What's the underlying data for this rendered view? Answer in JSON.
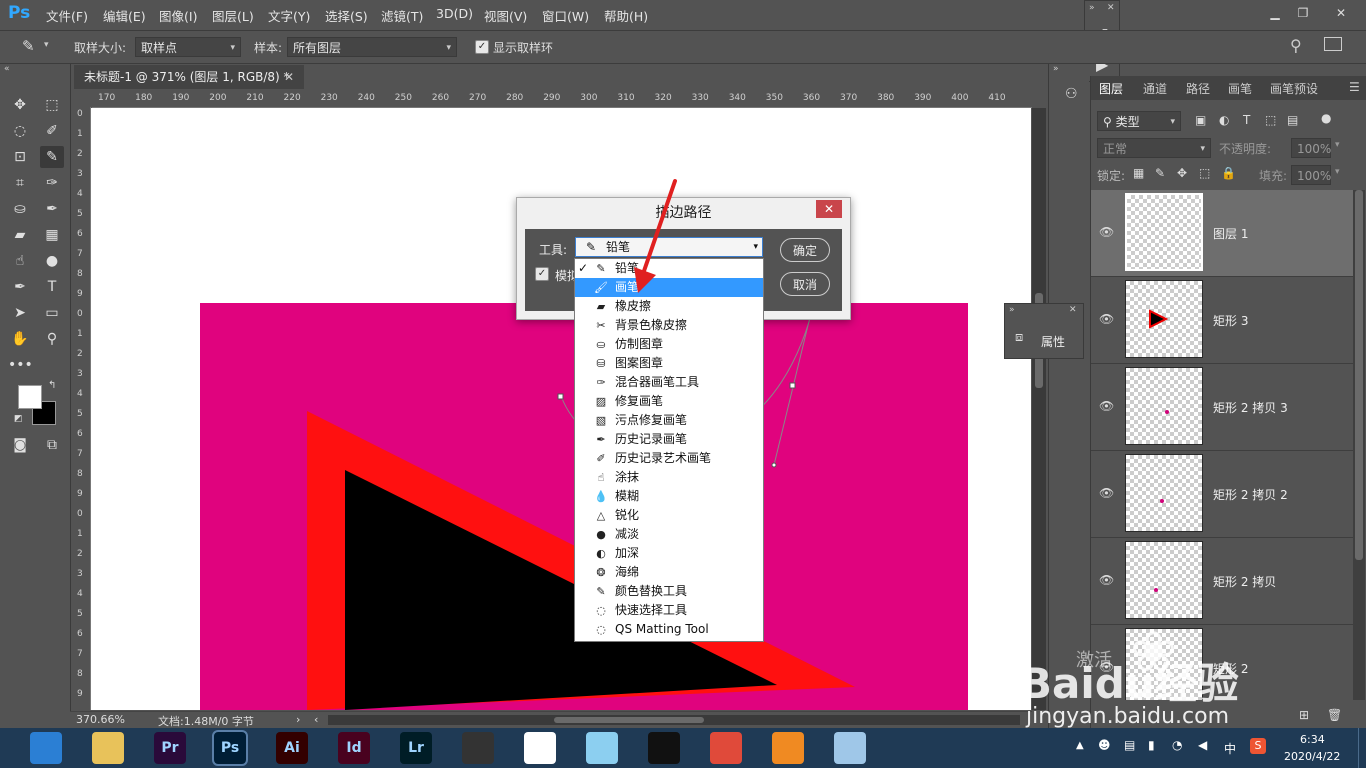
{
  "app": {
    "logo": "Ps"
  },
  "menu": [
    "文件(F)",
    "编辑(E)",
    "图像(I)",
    "图层(L)",
    "文字(Y)",
    "选择(S)",
    "滤镜(T)",
    "3D(D)",
    "视图(V)",
    "窗口(W)",
    "帮助(H)"
  ],
  "options": {
    "sample_size_label": "取样大小:",
    "sample_size_value": "取样点",
    "sample_label": "样本:",
    "sample_value": "所有图层",
    "show_ring_label": "显示取样环"
  },
  "document": {
    "tab_title": "未标题-1 @ 371% (图层 1, RGB/8) *",
    "zoom": "370.66%",
    "doc_info": "文档:1.48M/0 字节"
  },
  "ruler_h": [
    "170",
    "180",
    "190",
    "200",
    "210",
    "220",
    "230",
    "240",
    "250",
    "260",
    "270",
    "280",
    "290",
    "300",
    "310",
    "320",
    "330",
    "340",
    "350",
    "360",
    "370",
    "380",
    "390",
    "400",
    "410"
  ],
  "ruler_v": [
    "0",
    "1",
    "2",
    "3",
    "4",
    "5",
    "6",
    "7",
    "8",
    "9",
    "0",
    "1",
    "2",
    "3",
    "4",
    "5",
    "6",
    "7",
    "8",
    "9",
    "0",
    "1",
    "2",
    "3",
    "4",
    "5",
    "6",
    "7",
    "8",
    "9"
  ],
  "dialog": {
    "title": "描边路径",
    "close": "✕",
    "tool_label": "工具:",
    "tool_value": "铅笔",
    "simulate_label": "模拟",
    "ok": "确定",
    "cancel": "取消"
  },
  "tool_options": [
    {
      "label": "铅笔",
      "icon": "pencil-icon",
      "glyph": "✎",
      "checked": true
    },
    {
      "label": "画笔",
      "icon": "brush-icon",
      "glyph": "🖌",
      "selected": true
    },
    {
      "label": "橡皮擦",
      "icon": "eraser-icon",
      "glyph": "▰"
    },
    {
      "label": "背景色橡皮擦",
      "icon": "background-eraser-icon",
      "glyph": "✂"
    },
    {
      "label": "仿制图章",
      "icon": "clone-stamp-icon",
      "glyph": "⛀"
    },
    {
      "label": "图案图章",
      "icon": "pattern-stamp-icon",
      "glyph": "⛁"
    },
    {
      "label": "混合器画笔工具",
      "icon": "mixer-brush-icon",
      "glyph": "✑"
    },
    {
      "label": "修复画笔",
      "icon": "healing-brush-icon",
      "glyph": "▨"
    },
    {
      "label": "污点修复画笔",
      "icon": "spot-healing-icon",
      "glyph": "▧"
    },
    {
      "label": "历史记录画笔",
      "icon": "history-brush-icon",
      "glyph": "✒"
    },
    {
      "label": "历史记录艺术画笔",
      "icon": "art-history-brush-icon",
      "glyph": "✐"
    },
    {
      "label": "涂抹",
      "icon": "smudge-icon",
      "glyph": "☝"
    },
    {
      "label": "模糊",
      "icon": "blur-icon",
      "glyph": "💧"
    },
    {
      "label": "锐化",
      "icon": "sharpen-icon",
      "glyph": "△"
    },
    {
      "label": "减淡",
      "icon": "dodge-icon",
      "glyph": "●"
    },
    {
      "label": "加深",
      "icon": "burn-icon",
      "glyph": "◐"
    },
    {
      "label": "海绵",
      "icon": "sponge-icon",
      "glyph": "❂"
    },
    {
      "label": "颜色替换工具",
      "icon": "color-replace-icon",
      "glyph": "✎"
    },
    {
      "label": "快速选择工具",
      "icon": "quick-select-icon",
      "glyph": "◌"
    },
    {
      "label": "QS Matting Tool",
      "icon": "qs-matting-icon",
      "glyph": "◌"
    }
  ],
  "panel": {
    "tabs": [
      "图层",
      "通道",
      "路径",
      "画笔",
      "画笔预设"
    ],
    "filter_label": "类型",
    "blend_mode": "正常",
    "opacity_label": "不透明度:",
    "opacity_value": "100%",
    "lock_label": "锁定:",
    "fill_label": "填充:",
    "fill_value": "100%",
    "layers": [
      "图层 1",
      "矩形 3",
      "矩形 2 拷贝 3",
      "矩形 2 拷贝 2",
      "矩形 2 拷贝",
      "矩形 2"
    ],
    "properties_label": "属性"
  },
  "taskbar": {
    "time": "6:34",
    "date": "2020/4/22",
    "ime": "中",
    "apps": [
      {
        "name": "browser-icon",
        "label": "",
        "color": "#2b7fd4"
      },
      {
        "name": "file-explorer-icon",
        "label": "",
        "color": "#e8c25a"
      },
      {
        "name": "premiere-icon",
        "label": "Pr",
        "color": "#2a0a3a"
      },
      {
        "name": "photoshop-icon",
        "label": "Ps",
        "color": "#001e36"
      },
      {
        "name": "illustrator-icon",
        "label": "Ai",
        "color": "#330000"
      },
      {
        "name": "indesign-icon",
        "label": "Id",
        "color": "#49021f"
      },
      {
        "name": "lightroom-icon",
        "label": "Lr",
        "color": "#001d26"
      },
      {
        "name": "video-editor-icon",
        "label": "",
        "color": "#333"
      },
      {
        "name": "umbrella-app-icon",
        "label": "",
        "color": "#fff"
      },
      {
        "name": "chat-bird-icon",
        "label": "",
        "color": "#8ccff0"
      },
      {
        "name": "qq-icon",
        "label": "",
        "color": "#111"
      },
      {
        "name": "chrome-icon",
        "label": "",
        "color": "#e04a3a"
      },
      {
        "name": "orange-app-icon",
        "label": "",
        "color": "#f08a22"
      },
      {
        "name": "notepad-icon",
        "label": "",
        "color": "#9fc7e8"
      }
    ]
  },
  "watermark": {
    "brand": "Baidu经验",
    "url": "jingyan.baidu.com",
    "activate": "激活"
  }
}
